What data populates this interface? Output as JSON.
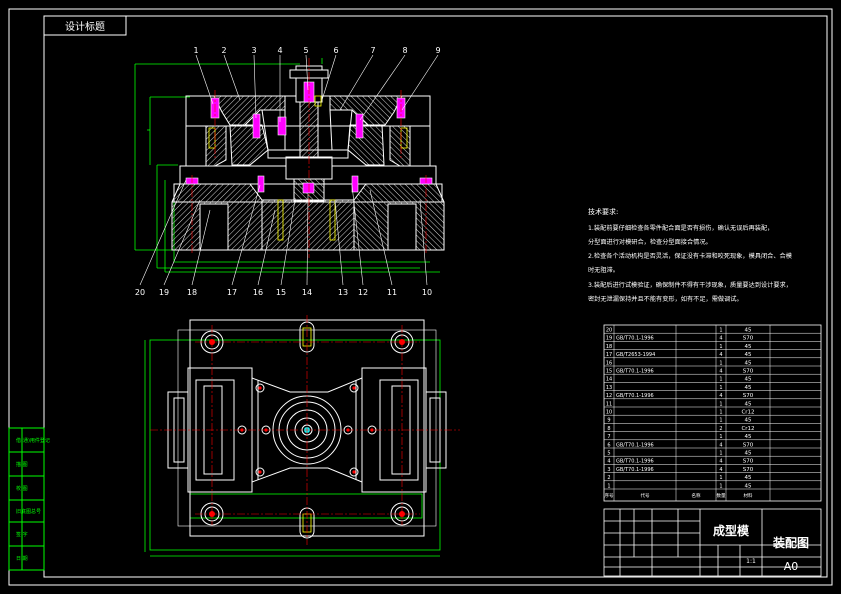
{
  "title_tag": "设计标题",
  "part_numbers_top": [
    "1",
    "2",
    "3",
    "4",
    "5",
    "6",
    "7",
    "8",
    "9"
  ],
  "part_numbers_bottom": [
    "20",
    "19",
    "18",
    "17",
    "16",
    "15",
    "14",
    "13",
    "12",
    "11",
    "10"
  ],
  "tech_requirements": {
    "heading": "技术要求:",
    "lines": [
      "1.装配前要仔细检查各零件配合面是否有损伤，确认无误后再装配，",
      "分型面进行对模研合，检查分型面接合情况。",
      "2.检查各个活动机构是否灵活，保证没有卡滞和咬死现象，模具闭合、合模",
      "时无阻滞。",
      "3.装配后进行试模验证，确保制件不得有干涉现象，质量要达到设计要求，",
      "密封无泄漏保持并且不能有变形，如有不足，需做调试。"
    ]
  },
  "left_column": [
    "借(通)用件登记",
    "描 图",
    "校 图",
    "旧底图总号",
    "签 字",
    "日 期"
  ],
  "bom": {
    "rows": [
      {
        "no": "20",
        "std": "",
        "name": "",
        "qty": "1",
        "mat": "45"
      },
      {
        "no": "19",
        "std": "GB/T70.1-1996",
        "name": "",
        "qty": "4",
        "mat": "S70"
      },
      {
        "no": "18",
        "std": "",
        "name": "",
        "qty": "1",
        "mat": "45"
      },
      {
        "no": "17",
        "std": "GB/T2653-1994",
        "name": "",
        "qty": "4",
        "mat": "45"
      },
      {
        "no": "16",
        "std": "",
        "name": "",
        "qty": "1",
        "mat": "45"
      },
      {
        "no": "15",
        "std": "GB/T70.1-1996",
        "name": "",
        "qty": "4",
        "mat": "S70"
      },
      {
        "no": "14",
        "std": "",
        "name": "",
        "qty": "1",
        "mat": "45"
      },
      {
        "no": "13",
        "std": "",
        "name": "",
        "qty": "1",
        "mat": "45"
      },
      {
        "no": "12",
        "std": "GB/T70.1-1996",
        "name": "",
        "qty": "4",
        "mat": "S70"
      },
      {
        "no": "11",
        "std": "",
        "name": "",
        "qty": "1",
        "mat": "45"
      },
      {
        "no": "10",
        "std": "",
        "name": "",
        "qty": "1",
        "mat": "Cr12"
      },
      {
        "no": "9",
        "std": "",
        "name": "",
        "qty": "1",
        "mat": "45"
      },
      {
        "no": "8",
        "std": "",
        "name": "",
        "qty": "2",
        "mat": "Cr12"
      },
      {
        "no": "7",
        "std": "",
        "name": "",
        "qty": "1",
        "mat": "45"
      },
      {
        "no": "6",
        "std": "GB/T70.1-1996",
        "name": "",
        "qty": "4",
        "mat": "S70"
      },
      {
        "no": "5",
        "std": "",
        "name": "",
        "qty": "1",
        "mat": "45"
      },
      {
        "no": "4",
        "std": "GB/T70.1-1996",
        "name": "",
        "qty": "4",
        "mat": "S70"
      },
      {
        "no": "3",
        "std": "GB/T70.1-1996",
        "name": "",
        "qty": "4",
        "mat": "S70"
      },
      {
        "no": "2",
        "std": "",
        "name": "",
        "qty": "1",
        "mat": "45"
      },
      {
        "no": "1",
        "std": "",
        "name": "",
        "qty": "1",
        "mat": "45"
      }
    ],
    "header": {
      "no": "序号",
      "std": "代号",
      "name": "名称",
      "qty": "数量",
      "mat": "材料"
    }
  },
  "title_block": {
    "part_name": "成型模",
    "drawing_type": "装配图",
    "sheet_size": "A0",
    "scale": "1:1"
  },
  "colors": {
    "outline": "#ffffff",
    "part": "#ffffff",
    "dimension": "#00ff00",
    "center": "#ff0000",
    "fastener": "#ff00ff",
    "yellow": "#ffff00",
    "cyan": "#00ffff",
    "hatch": "#dddddd"
  }
}
